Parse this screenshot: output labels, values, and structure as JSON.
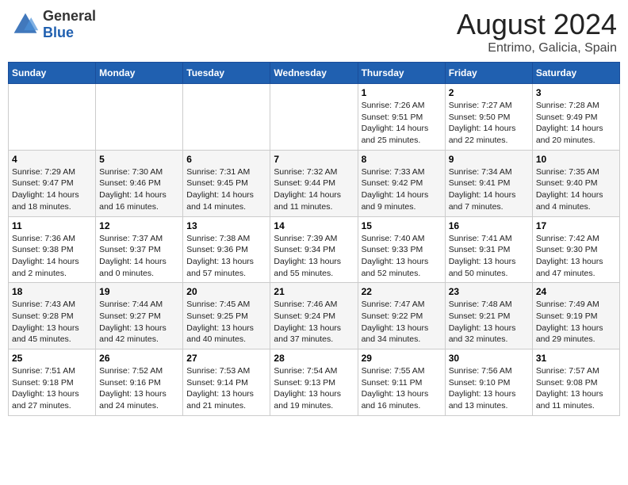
{
  "header": {
    "logo_general": "General",
    "logo_blue": "Blue",
    "title": "August 2024",
    "subtitle": "Entrimo, Galicia, Spain"
  },
  "columns": [
    "Sunday",
    "Monday",
    "Tuesday",
    "Wednesday",
    "Thursday",
    "Friday",
    "Saturday"
  ],
  "weeks": [
    [
      {
        "day": "",
        "info": ""
      },
      {
        "day": "",
        "info": ""
      },
      {
        "day": "",
        "info": ""
      },
      {
        "day": "",
        "info": ""
      },
      {
        "day": "1",
        "info": "Sunrise: 7:26 AM\nSunset: 9:51 PM\nDaylight: 14 hours\nand 25 minutes."
      },
      {
        "day": "2",
        "info": "Sunrise: 7:27 AM\nSunset: 9:50 PM\nDaylight: 14 hours\nand 22 minutes."
      },
      {
        "day": "3",
        "info": "Sunrise: 7:28 AM\nSunset: 9:49 PM\nDaylight: 14 hours\nand 20 minutes."
      }
    ],
    [
      {
        "day": "4",
        "info": "Sunrise: 7:29 AM\nSunset: 9:47 PM\nDaylight: 14 hours\nand 18 minutes."
      },
      {
        "day": "5",
        "info": "Sunrise: 7:30 AM\nSunset: 9:46 PM\nDaylight: 14 hours\nand 16 minutes."
      },
      {
        "day": "6",
        "info": "Sunrise: 7:31 AM\nSunset: 9:45 PM\nDaylight: 14 hours\nand 14 minutes."
      },
      {
        "day": "7",
        "info": "Sunrise: 7:32 AM\nSunset: 9:44 PM\nDaylight: 14 hours\nand 11 minutes."
      },
      {
        "day": "8",
        "info": "Sunrise: 7:33 AM\nSunset: 9:42 PM\nDaylight: 14 hours\nand 9 minutes."
      },
      {
        "day": "9",
        "info": "Sunrise: 7:34 AM\nSunset: 9:41 PM\nDaylight: 14 hours\nand 7 minutes."
      },
      {
        "day": "10",
        "info": "Sunrise: 7:35 AM\nSunset: 9:40 PM\nDaylight: 14 hours\nand 4 minutes."
      }
    ],
    [
      {
        "day": "11",
        "info": "Sunrise: 7:36 AM\nSunset: 9:38 PM\nDaylight: 14 hours\nand 2 minutes."
      },
      {
        "day": "12",
        "info": "Sunrise: 7:37 AM\nSunset: 9:37 PM\nDaylight: 14 hours\nand 0 minutes."
      },
      {
        "day": "13",
        "info": "Sunrise: 7:38 AM\nSunset: 9:36 PM\nDaylight: 13 hours\nand 57 minutes."
      },
      {
        "day": "14",
        "info": "Sunrise: 7:39 AM\nSunset: 9:34 PM\nDaylight: 13 hours\nand 55 minutes."
      },
      {
        "day": "15",
        "info": "Sunrise: 7:40 AM\nSunset: 9:33 PM\nDaylight: 13 hours\nand 52 minutes."
      },
      {
        "day": "16",
        "info": "Sunrise: 7:41 AM\nSunset: 9:31 PM\nDaylight: 13 hours\nand 50 minutes."
      },
      {
        "day": "17",
        "info": "Sunrise: 7:42 AM\nSunset: 9:30 PM\nDaylight: 13 hours\nand 47 minutes."
      }
    ],
    [
      {
        "day": "18",
        "info": "Sunrise: 7:43 AM\nSunset: 9:28 PM\nDaylight: 13 hours\nand 45 minutes."
      },
      {
        "day": "19",
        "info": "Sunrise: 7:44 AM\nSunset: 9:27 PM\nDaylight: 13 hours\nand 42 minutes."
      },
      {
        "day": "20",
        "info": "Sunrise: 7:45 AM\nSunset: 9:25 PM\nDaylight: 13 hours\nand 40 minutes."
      },
      {
        "day": "21",
        "info": "Sunrise: 7:46 AM\nSunset: 9:24 PM\nDaylight: 13 hours\nand 37 minutes."
      },
      {
        "day": "22",
        "info": "Sunrise: 7:47 AM\nSunset: 9:22 PM\nDaylight: 13 hours\nand 34 minutes."
      },
      {
        "day": "23",
        "info": "Sunrise: 7:48 AM\nSunset: 9:21 PM\nDaylight: 13 hours\nand 32 minutes."
      },
      {
        "day": "24",
        "info": "Sunrise: 7:49 AM\nSunset: 9:19 PM\nDaylight: 13 hours\nand 29 minutes."
      }
    ],
    [
      {
        "day": "25",
        "info": "Sunrise: 7:51 AM\nSunset: 9:18 PM\nDaylight: 13 hours\nand 27 minutes."
      },
      {
        "day": "26",
        "info": "Sunrise: 7:52 AM\nSunset: 9:16 PM\nDaylight: 13 hours\nand 24 minutes."
      },
      {
        "day": "27",
        "info": "Sunrise: 7:53 AM\nSunset: 9:14 PM\nDaylight: 13 hours\nand 21 minutes."
      },
      {
        "day": "28",
        "info": "Sunrise: 7:54 AM\nSunset: 9:13 PM\nDaylight: 13 hours\nand 19 minutes."
      },
      {
        "day": "29",
        "info": "Sunrise: 7:55 AM\nSunset: 9:11 PM\nDaylight: 13 hours\nand 16 minutes."
      },
      {
        "day": "30",
        "info": "Sunrise: 7:56 AM\nSunset: 9:10 PM\nDaylight: 13 hours\nand 13 minutes."
      },
      {
        "day": "31",
        "info": "Sunrise: 7:57 AM\nSunset: 9:08 PM\nDaylight: 13 hours\nand 11 minutes."
      }
    ]
  ]
}
